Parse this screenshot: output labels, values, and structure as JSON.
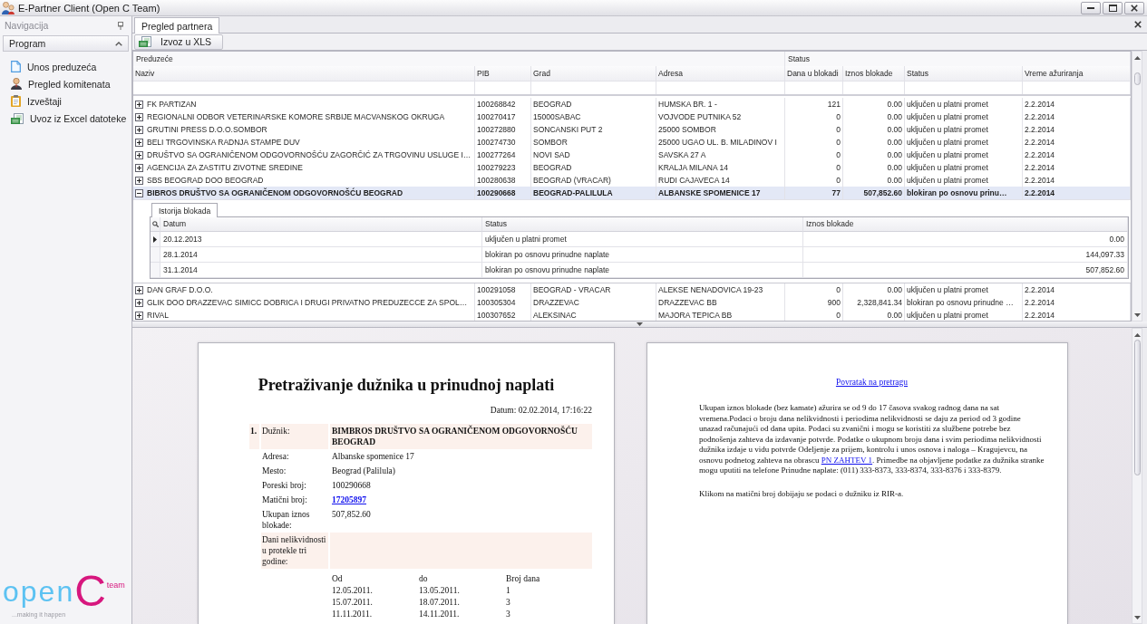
{
  "window": {
    "title": "E-Partner Client (Open C Team)"
  },
  "navigation": {
    "title": "Navigacija",
    "group": {
      "label": "Program",
      "expanded": true
    },
    "items": [
      {
        "label": "Unos preduzeća"
      },
      {
        "label": "Pregled komitenata"
      },
      {
        "label": "Izveštaji"
      },
      {
        "label": "Uvoz iz Excel datoteke"
      }
    ]
  },
  "logo": {
    "word": "open",
    "letter": "C",
    "suffix": "team",
    "tagline": "...making it happen"
  },
  "tabs": [
    {
      "label": "Pregled partnera",
      "selected": true
    }
  ],
  "toolbar": {
    "export_button": "Izvoz u XLS"
  },
  "grid": {
    "bands": [
      {
        "label": "Preduzeće",
        "columns": [
          "Naziv",
          "PIB",
          "Grad",
          "Adresa"
        ]
      },
      {
        "label": "Status",
        "columns": [
          "Dana u blokadi",
          "Iznos blokade",
          "Status",
          "Vreme ažuriranja"
        ]
      }
    ],
    "rows": [
      {
        "cells": [
          "FK PARTIZAN",
          "100268842",
          "BEOGRAD",
          "HUMSKA BR. 1 -",
          "121",
          "0.00",
          "uključen u platni promet",
          "2.2.2014"
        ],
        "expanded": false,
        "selected": false
      },
      {
        "cells": [
          "REGIONALNI ODBOR VETERINARSKE KOMORE SRBIJE MACVANSKOG OKRUGA",
          "100270417",
          "15000SABAC",
          "VOJVODE PUTNIKA 52",
          "0",
          "0.00",
          "uključen u platni promet",
          "2.2.2014"
        ],
        "expanded": false,
        "selected": false
      },
      {
        "cells": [
          "GRUTINI PRESS D.O.O.SOMBOR",
          "100272880",
          "SONCANSKI PUT 2",
          "25000 SOMBOR",
          "0",
          "0.00",
          "uključen u platni promet",
          "2.2.2014"
        ],
        "expanded": false,
        "selected": false
      },
      {
        "cells": [
          "BELI TRGOVINSKA RADNJA STAMPE DUV",
          "100274730",
          "SOMBOR",
          "25000 UGAO UL. B. MILADINOV I",
          "0",
          "0.00",
          "uključen u platni promet",
          "2.2.2014"
        ],
        "expanded": false,
        "selected": false
      },
      {
        "cells": [
          "DRUŠTVO SA OGRANIČENOM ODGOVORNOŠĆU ZAGORČIĆ ZA TRGOVINU USLUGE I…",
          "100277264",
          "NOVI SAD",
          "SAVSKA 27 A",
          "0",
          "0.00",
          "uključen u platni promet",
          "2.2.2014"
        ],
        "expanded": false,
        "selected": false
      },
      {
        "cells": [
          "AGENCIJA ZA ZASTITU ZIVOTNE SREDINE",
          "100279223",
          "BEOGRAD",
          "KRALJA MILANA 14",
          "0",
          "0.00",
          "uključen u platni promet",
          "2.2.2014"
        ],
        "expanded": false,
        "selected": false
      },
      {
        "cells": [
          "SBS BEOGRAD DOO BEOGRAD",
          "100280638",
          "BEOGRAD (VRACAR)",
          "RUDI CAJAVECA 14",
          "0",
          "0.00",
          "uključen u platni promet",
          "2.2.2014"
        ],
        "expanded": false,
        "selected": false
      },
      {
        "cells": [
          "BIBROS DRUŠTVO SA OGRANIČENOM ODGOVORNOŠĆU BEOGRAD",
          "100290668",
          "BEOGRAD-PALILULA",
          "ALBANSKE SPOMENICE 17",
          "77",
          "507,852.60",
          "blokiran po osnovu prinu…",
          "2.2.2014"
        ],
        "expanded": true,
        "selected": true,
        "detail": {
          "tabs": [
            {
              "label": "Istorija blokada",
              "selected": true
            }
          ],
          "columns": [
            "Datum",
            "Status",
            "Iznos blokade"
          ],
          "rows": [
            {
              "cells": [
                "20.12.2013",
                "uključen u platni promet",
                "0.00"
              ],
              "selected": true
            },
            {
              "cells": [
                "28.1.2014",
                "blokiran po osnovu prinudne naplate",
                "144,097.33"
              ],
              "selected": false
            },
            {
              "cells": [
                "31.1.2014",
                "blokiran po osnovu prinudne naplate",
                "507,852.60"
              ],
              "selected": false
            }
          ]
        }
      },
      {
        "cells": [
          "DAN GRAF D.O.O.",
          "100291058",
          "BEOGRAD - VRACAR",
          "ALEKSE NENADOVICA 19-23",
          "0",
          "0.00",
          "uključen u platni promet",
          "2.2.2014"
        ],
        "expanded": false,
        "selected": false
      },
      {
        "cells": [
          "GLIK DOO DRAZZEVAC SIMICC DOBRICA I DRUGI PRIVATNO PREDUZECCE ZA SPOL…",
          "100305304",
          "DRAZZEVAC",
          "DRAZZEVAC BB",
          "900",
          "2,328,841.34",
          "blokiran po osnovu prinudne …",
          "2.2.2014"
        ],
        "expanded": false,
        "selected": false
      },
      {
        "cells": [
          "RIVAL",
          "100307652",
          "ALEKSINAC",
          "MAJORA TEPICA BB",
          "0",
          "0.00",
          "uključen u platni promet",
          "2.2.2014"
        ],
        "expanded": false,
        "selected": false
      }
    ]
  },
  "report": {
    "title": "Pretraživanje dužnika u prinudnoj naplati",
    "date": "Datum: 02.02.2014, 17:16:22",
    "entries": [
      {
        "kind": "heading",
        "number": "1.",
        "label": "Dužnik:",
        "value": "BIMBROS DRUŠTVO SA OGRANIČENOM ODGOVORNOŠĆU BEOGRAD"
      },
      {
        "kind": "text",
        "label": "Adresa:",
        "value": "Albanske spomenice 17"
      },
      {
        "kind": "text",
        "label": "Mesto:",
        "value": "Beograd (Palilula)"
      },
      {
        "kind": "text",
        "label": "Poreski broj:",
        "value": "100290668"
      },
      {
        "kind": "link",
        "label": "Matični broj:",
        "value": "17205897"
      },
      {
        "kind": "text",
        "label": "Ukupan iznos blokade:",
        "value": "507,852.60"
      },
      {
        "kind": "heading",
        "label": "Dani nelikvidnosti u protekle tri godine:"
      }
    ],
    "periods": {
      "columns": [
        "Od",
        "do",
        "Broj dana"
      ],
      "rows": [
        [
          "12.05.2011.",
          "13.05.2011.",
          "1"
        ],
        [
          "15.07.2011.",
          "18.07.2011.",
          "3"
        ],
        [
          "11.11.2011.",
          "14.11.2011.",
          "3"
        ]
      ]
    }
  },
  "info": {
    "back_link": "Povratak na pretragu",
    "paragraph": {
      "before": "Ukupan iznos blokade (bez kamate) ažurira se od 9 do 17 časova svakog radnog dana na sat vremena.Podaci o broju dana nelikvidnosti i periodima nelikvidnosti se daju za period od 3 godine unazad računajući od dana upita. Podaci su zvanični i mogu se koristiti za službene potrebe bez podnošenja zahteva da izdavanje potvrde. Podatke o ukupnom broju dana i svim periodima nelikvidnosti dužnika izdaje u vidu potvrde Odeljenje za prijem, kontrolu i unos osnova i naloga – Kragujevcu, na osnovu podnetog zahteva na obrascu ",
      "link": "PN ZAHTEV 1",
      "after": ". Primedbe na objavljene podatke za dužnika stranke mogu uputiti na telefone Prinudne naplate: (011) 333-8373, 333-8374, 333-8376 i 333-8379."
    },
    "note": "Klikom na matični broj dobijaju se podaci o dužniku iz RIR-a."
  }
}
